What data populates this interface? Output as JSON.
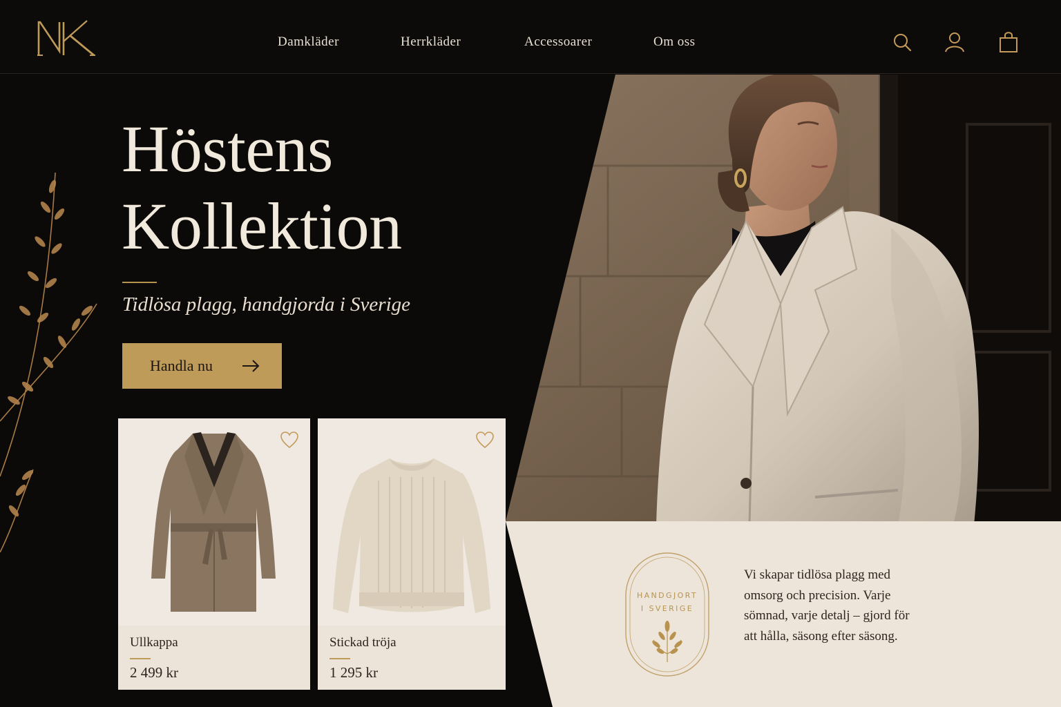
{
  "brand": {
    "logo_text": "NK",
    "accent": "#bf9b5a",
    "background": "#0c0a09",
    "panel": "#ece4d8"
  },
  "nav": {
    "items": [
      {
        "label": "Damkläder"
      },
      {
        "label": "Herrkläder"
      },
      {
        "label": "Accessoarer"
      },
      {
        "label": "Om oss"
      }
    ]
  },
  "header_icons": [
    "search-icon",
    "account-icon",
    "shopping-bag-icon"
  ],
  "hero": {
    "title_line1": "Höstens",
    "title_line2": "Kollektion",
    "subtitle": "Tidlösa plagg, handgjorda i Sverige",
    "cta_label": "Handla nu"
  },
  "products": [
    {
      "name": "Ullkappa",
      "price": "2 499 kr",
      "favorite": false
    },
    {
      "name": "Stickad tröja",
      "price": "1 295 kr",
      "favorite": false
    }
  ],
  "badge": {
    "line1": "HANDGJORT",
    "line2": "I SVERIGE"
  },
  "about": {
    "text": "Vi skapar tidlösa plagg med omsorg och precision. Varje sömnad, varje detalj – gjord för att hålla, säsong efter säsong."
  }
}
